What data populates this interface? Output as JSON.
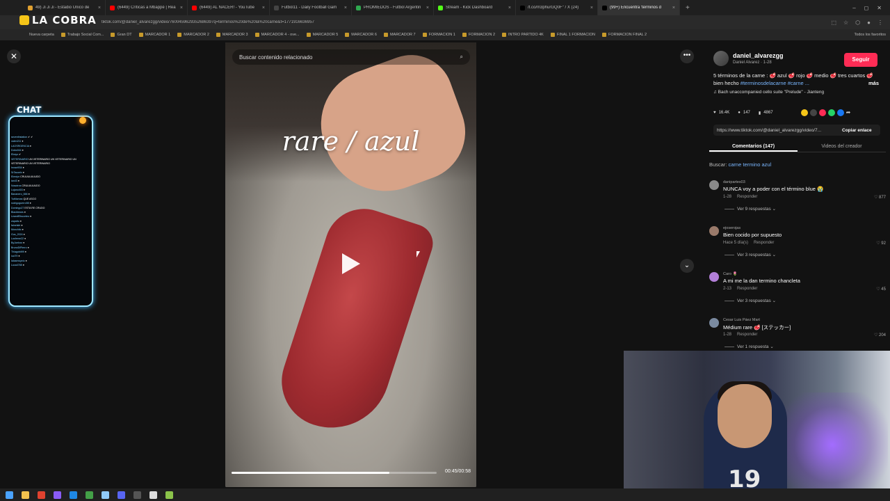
{
  "browser": {
    "tabs": [
      {
        "title": "49) Ji Ji Ji - Estadio Único de",
        "color": "#e0a030"
      },
      {
        "title": "(6449) Críticas a Mbappé | Rea",
        "color": "#ff0000"
      },
      {
        "title": "(6449) AL NACER! - YouTube",
        "color": "#ff0000"
      },
      {
        "title": "Futbol11 - Daily Football Gam",
        "color": "#444444"
      },
      {
        "title": "PROMIEDOS - Futbol Argentin",
        "color": "#2fa84f"
      },
      {
        "title": "Stream - Kick Dashboard",
        "color": "#53fc18"
      },
      {
        "title": "/t.co/m3phurGQ0F\" / X (24)",
        "color": "#000000"
      },
      {
        "title": "(99+) Encuentra 'términos d",
        "color": "#000000"
      }
    ],
    "new_tab": "+",
    "window_controls": [
      "–",
      "◻",
      "✕"
    ],
    "url": "tiktok.com/@daniel_alvarezgg/video/7600459629352686397q=terminos%20de%20la%20carne&t=1771916636957",
    "logo_text": "LA COBRA",
    "new_folder": "Nueva carpeta",
    "bookmarks": [
      "Trabajo Social Com...",
      "Gran DT",
      "MARCADOR 1",
      "MARCADOR 2",
      "MARCADOR 3",
      "MARCADOR 4 - ove...",
      "MARCADOR 5",
      "MARCADOR 6",
      "MARCADOR 7",
      "FORMACION 1",
      "FORMACION 2",
      "INTRO PARTIDO 4K",
      "FINAL 1 FORMACION",
      "FORMACION FINAL 2"
    ],
    "favorites": "Todos los favoritos"
  },
  "overlay": {
    "chat_title": "CHAT",
    "chat_lines": [
      {
        "user": "seventhstation",
        "msg": " ✔ ✔"
      },
      {
        "user": "valen211",
        "msg": " ●"
      },
      {
        "user": "LAOSRGENCIA",
        "msg": " ●"
      },
      {
        "user": "Dobo044",
        "msg": " ●"
      },
      {
        "user": "Elrayo",
        "msg": " ✔"
      },
      {
        "user": "VETERINARIO",
        "msg": " UN VETERINARIO UN VETERINARIO UN"
      },
      {
        "user": "",
        "msg": "VETERINARIO UN VETERINARIO"
      },
      {
        "user": "Invact934",
        "msg": " ●"
      },
      {
        "user": "SrTacoelv",
        "msg": " ●"
      },
      {
        "user": "Elmejor",
        "msg": " CRUUUUUUUDO"
      },
      {
        "user": "ian43",
        "msg": " ●"
      },
      {
        "user": "Nosotros",
        "msg": " CRUUUUUUDO"
      },
      {
        "user": "Lujano403",
        "msg": " ●"
      },
      {
        "user": "Bananero_666",
        "msg": " ●"
      },
      {
        "user": "Tuttilamas",
        "msg": " QUE ASCO"
      },
      {
        "user": "rodrigoguerro98",
        "msg": " ●"
      },
      {
        "user": "Domingo27",
        "msg": " ESTA RE CRUDO"
      },
      {
        "user": "Blackbears",
        "msg": " ●"
      },
      {
        "user": "LeandElbuceteo",
        "msg": " ●"
      },
      {
        "user": "zapattu",
        "msg": " ●"
      },
      {
        "user": "fainelsfe",
        "msg": " ●"
      },
      {
        "user": "Monchito",
        "msg": " ●"
      },
      {
        "user": "Gus_2024",
        "msg": " ●"
      },
      {
        "user": "Losfrene22",
        "msg": " ●"
      },
      {
        "user": "ByJoelxxx",
        "msg": " ●"
      },
      {
        "user": "BrunoDiPierro",
        "msg": " ●"
      },
      {
        "user": "Thiagobit99",
        "msg": " ●"
      },
      {
        "user": "iuci79",
        "msg": " ●"
      },
      {
        "user": "lalxamwyeio",
        "msg": " ●"
      },
      {
        "user": "Luca4785",
        "msg": " ●"
      }
    ]
  },
  "video": {
    "search_placeholder": "Buscar contenido relacionado",
    "title_overlay": "rare / azul",
    "time": "00:45/00:58",
    "progress": 0.77
  },
  "panel": {
    "username": "daniel_alvarezgg",
    "subline": "Daniel Alvarez · 1-28",
    "follow": "Seguir",
    "description": "5 términos de la carne : 🥩 azul 🥩 rojo 🥩 medio 🥩 tres cuartos 🥩 bien hecho",
    "hashtags": "#terminosdelacarne #carne ...",
    "more": "más",
    "music": "♫  Bach unaccompanied cello suite \"Prelude\" - Jianteng",
    "likes": "16.4K",
    "comments": "147",
    "saves": "4867",
    "link": "https://www.tiktok.com/@daniel_alvarezgg/video/7...",
    "copy": "Copiar enlace",
    "tab_comments": "Comentarios (147)",
    "tab_videos": "Videos del creador",
    "search_label": "Buscar: ",
    "search_term": "carne termino azul",
    "reply": "Responder"
  },
  "comments": [
    {
      "user": "danipartes03",
      "text": "NUNCA voy a poder con el término blue 😭",
      "date": "1-28",
      "likes": "♡ 877",
      "replies": "Ver 9 respuestas ⌄"
    },
    {
      "user": "ejoserojas",
      "text": "Bien cocido por supuesto",
      "date": "Hace 5 día(s)",
      "likes": "♡ 92",
      "replies": "Ver 3 respuestas ⌄"
    },
    {
      "user": "Caro 🌷",
      "text": "A mi me la dan termino chancleta",
      "date": "2-13",
      "likes": "♡ 45",
      "replies": "Ver 3 respuestas ⌄"
    },
    {
      "user": "Cesar Luis Páez Mart",
      "text": "Médium rare 🥩 [ステッカー]",
      "date": "1-28",
      "likes": "♡ 204",
      "replies": "Ver 1 respuesta ⌄"
    }
  ],
  "webcam": {
    "jersey_number": "19"
  },
  "icons": [
    "close-icon",
    "more-icon",
    "chevron-down-icon",
    "play-icon",
    "search-icon",
    "heart-icon",
    "comment-icon",
    "bookmark-icon",
    "share-icon"
  ]
}
